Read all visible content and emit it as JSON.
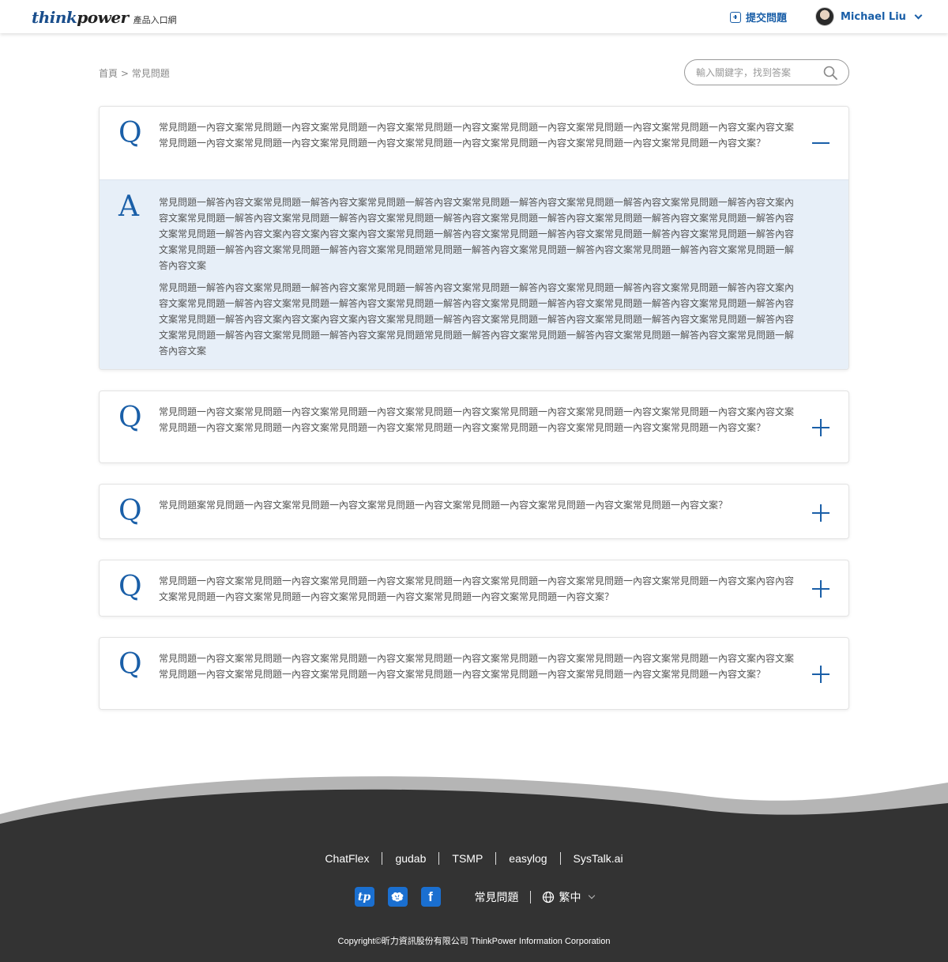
{
  "header": {
    "logo_think": "think",
    "logo_power": "power",
    "logo_sub": "產品入口網",
    "submit_label": "提交問題",
    "user_name": "Michael Liu"
  },
  "breadcrumb": {
    "home": "首頁",
    "separator": ">",
    "current": "常見問題"
  },
  "search": {
    "placeholder": "輸入關鍵字，找到答案"
  },
  "faqs": [
    {
      "q_letter": "Q",
      "question": "常見問題一內容文案常見問題一內容文案常見問題一內容文案常見問題一內容文案常見問題一內容文案常見問題一內容文案常見問題一內容文案內容文案常見問題一內容文案常見問題一內容文案常見問題一內容文案常見問題一內容文案常見問題一內容文案常見問題一內容文案常見問題一內容文案？",
      "expanded": true,
      "a_letter": "A",
      "answers": [
        "常見問題一解答內容文案常見問題一解答內容文案常見問題一解答內容文案常見問題一解答內容文案常見問題一解答內容文案常見問題一解答內容文案內容文案常見問題一解答內容文案常見問題一解答內容文案常見問題一解答內容文案常見問題一解答內容文案常見問題一解答內容文案常見問題一解答內容文案常見問題一解答內容文案內容文案內容文案內容文案常見問題一解答內容文案常見問題一解答內容文案常見問題一解答內容文案常見問題一解答內容文案常見問題一解答內容文案常見問題一解答內容文案常見問題常見問題一解答內容文案常見問題一解答內容文案常見問題一解答內容文案常見問題一解答內容文案",
        "常見問題一解答內容文案常見問題一解答內容文案常見問題一解答內容文案常見問題一解答內容文案常見問題一解答內容文案常見問題一解答內容文案內容文案常見問題一解答內容文案常見問題一解答內容文案常見問題一解答內容文案常見問題一解答內容文案常見問題一解答內容文案常見問題一解答內容文案常見問題一解答內容文案內容文案內容文案內容文案常見問題一解答內容文案常見問題一解答內容文案常見問題一解答內容文案常見問題一解答內容文案常見問題一解答內容文案常見問題一解答內容文案常見問題常見問題一解答內容文案常見問題一解答內容文案常見問題一解答內容文案常見問題一解答內容文案"
      ]
    },
    {
      "q_letter": "Q",
      "question": "常見問題一內容文案常見問題一內容文案常見問題一內容文案常見問題一內容文案常見問題一內容文案常見問題一內容文案常見問題一內容文案內容文案常見問題一內容文案常見問題一內容文案常見問題一內容文案常見問題一內容文案常見問題一內容文案常見問題一內容文案常見問題一內容文案？",
      "expanded": false
    },
    {
      "q_letter": "Q",
      "question": "常見問題案常見問題一內容文案常見問題一內容文案常見問題一內容文案常見問題一內容文案常見問題一內容文案常見問題一內容文案？",
      "expanded": false
    },
    {
      "q_letter": "Q",
      "question": "常見問題一內容文案常見問題一內容文案常見問題一內容文案常見問題一內容文案常見問題一內容文案常見問題一內容文案常見問題一內容文案內容內容文案常見問題一內容文案常見問題一內容文案常見問題一內容文案常見問題一內容文案常見問題一內容文案？",
      "expanded": false
    },
    {
      "q_letter": "Q",
      "question": "常見問題一內容文案常見問題一內容文案常見問題一內容文案常見問題一內容文案常見問題一內容文案常見問題一內容文案常見問題一內容文案內容文案常見問題一內容文案常見問題一內容文案常見問題一內容文案常見問題一內容文案常見問題一內容文案常見問題一內容文案常見問題一內容文案？",
      "expanded": false
    }
  ],
  "footer": {
    "links": [
      "ChatFlex",
      "gudab",
      "TSMP",
      "easylog",
      "SysTalk.ai"
    ],
    "social_tp": "tp",
    "social_fb": "f",
    "faq_label": "常見問題",
    "lang_label": "繁中",
    "copyright": "Copyright©昕力資訊股份有限公司 ThinkPower Information Corporation",
    "bg_color": "#333333",
    "wave_color": "#b5b5b5"
  },
  "colors": {
    "accent": "#1a5fa8",
    "answer_bg": "#e7eff8"
  }
}
